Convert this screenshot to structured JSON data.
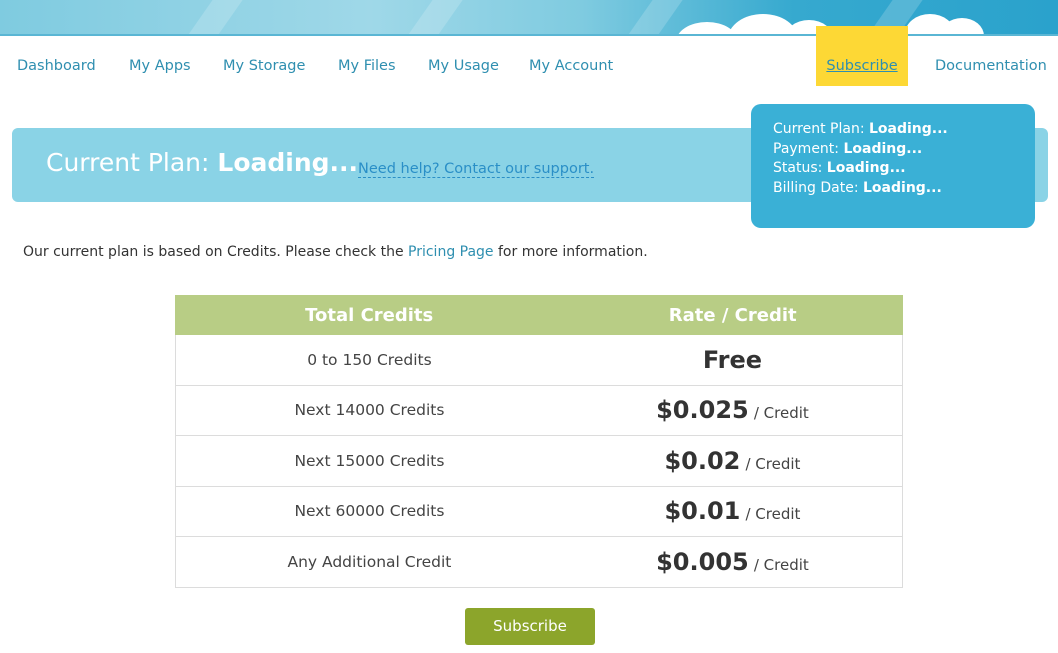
{
  "nav": {
    "items": [
      {
        "label": "Dashboard"
      },
      {
        "label": "My Apps"
      },
      {
        "label": "My Storage"
      },
      {
        "label": "My Files"
      },
      {
        "label": "My Usage"
      },
      {
        "label": "My Account"
      }
    ],
    "subscribe_label": "Subscribe",
    "documentation_label": "Documentation",
    "subscribe_bg": "#fdd835"
  },
  "plan": {
    "title_prefix": "Current Plan:",
    "title_value": "Loading...",
    "help_link": "Need help? Contact our support."
  },
  "info_card": {
    "current_plan_label": "Current Plan:",
    "current_plan_value": "Loading...",
    "payment_label": "Payment:",
    "payment_value": "Loading...",
    "status_label": "Status:",
    "status_value": "Loading...",
    "billing_label": "Billing Date:",
    "billing_value": "Loading..."
  },
  "intro": {
    "before": "Our current plan is based on Credits. Please check the ",
    "link": "Pricing Page",
    "after": " for more information."
  },
  "pricing": {
    "headers": [
      "Total Credits",
      "Rate / Credit"
    ],
    "rows": [
      {
        "credits": "0 to 150 Credits",
        "price": "Free",
        "unit": ""
      },
      {
        "credits": "Next 14000 Credits",
        "price": "$0.025",
        "unit": "/ Credit"
      },
      {
        "credits": "Next 15000 Credits",
        "price": "$0.02",
        "unit": "/ Credit"
      },
      {
        "credits": "Next 60000 Credits",
        "price": "$0.01",
        "unit": "/ Credit"
      },
      {
        "credits": "Any Additional Credit",
        "price": "$0.005",
        "unit": "/ Credit"
      }
    ],
    "header_bg": "#b8cd85"
  },
  "subscribe_button": "Subscribe",
  "colors": {
    "banner": "#8ad3e6",
    "info_card": "#3ab0d6",
    "button": "#8ca52b",
    "link": "#2f8fb0"
  }
}
